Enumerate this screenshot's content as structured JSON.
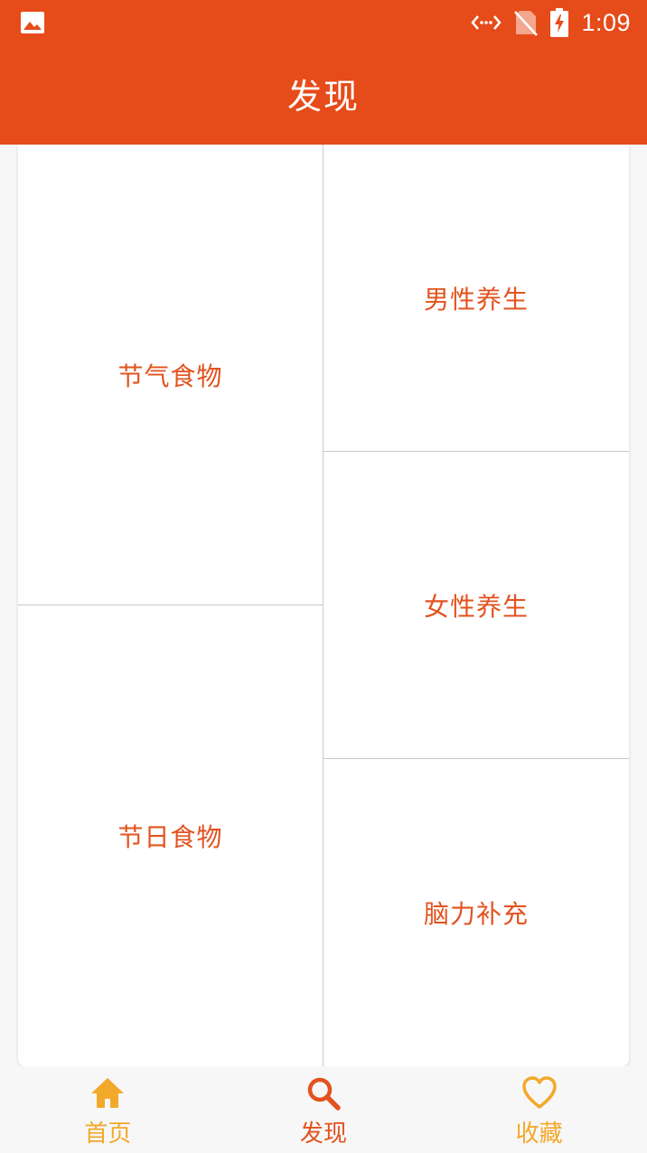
{
  "status_bar": {
    "time": "1:09",
    "icons": [
      "gallery-icon",
      "data-transfer-icon",
      "no-sim-icon",
      "battery-charging-icon"
    ]
  },
  "header": {
    "title": "发现"
  },
  "grid": {
    "items": [
      {
        "label": "节气食物"
      },
      {
        "label": "节日食物"
      },
      {
        "label": "男性养生"
      },
      {
        "label": "女性养生"
      },
      {
        "label": "脑力补充"
      }
    ]
  },
  "bottom_nav": {
    "items": [
      {
        "label": "首页",
        "icon": "home-icon",
        "color": "#f2a92a"
      },
      {
        "label": "发现",
        "icon": "search-icon",
        "color": "#e2531f",
        "active": true
      },
      {
        "label": "收藏",
        "icon": "heart-icon",
        "color": "#f2a92a"
      }
    ]
  },
  "colors": {
    "primary": "#e64b1a",
    "accent_text": "#e2531f",
    "inactive_nav": "#f2a92a"
  }
}
